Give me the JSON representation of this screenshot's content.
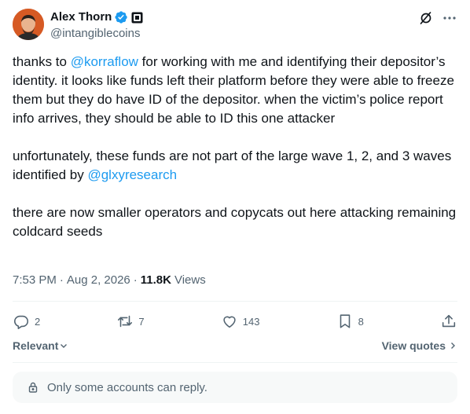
{
  "author": {
    "display_name": "Alex Thorn",
    "handle": "@intangiblecoins"
  },
  "header_icons": [
    "verified-badge-icon",
    "affiliate-badge-icon",
    "grok-icon",
    "more-icon"
  ],
  "post": {
    "paragraph1": {
      "before": "thanks to ",
      "mention": "@korraflow",
      "after": " for working with me and identifying their depositor’s identity. it looks like funds left their platform before they were able to freeze them but they do have ID of the depositor. when the victim’s police report info arrives, they should be able to ID this one attacker"
    },
    "paragraph2": {
      "before": "unfortunately, these funds are not part of the large wave 1, 2, and 3 waves identified by ",
      "mention": "@glxyresearch"
    },
    "paragraph3": "there are now smaller operators and copycats out here attacking remaining coldcard seeds"
  },
  "meta": {
    "time": "7:53 PM",
    "separator": "·",
    "date": "Aug 2, 2026",
    "views_count": "11.8K",
    "views_label": "Views"
  },
  "actions": {
    "replies": "2",
    "reposts": "7",
    "likes": "143",
    "bookmarks": "8"
  },
  "footer": {
    "sort_label": "Relevant",
    "view_quotes": "View quotes"
  },
  "reply_restriction": "Only some accounts can reply.",
  "colors": {
    "accent": "#1d9bf0",
    "text": "#0f1419",
    "secondary": "#536471",
    "divider": "#eff3f4",
    "notice_bg": "#f7f9f9"
  }
}
